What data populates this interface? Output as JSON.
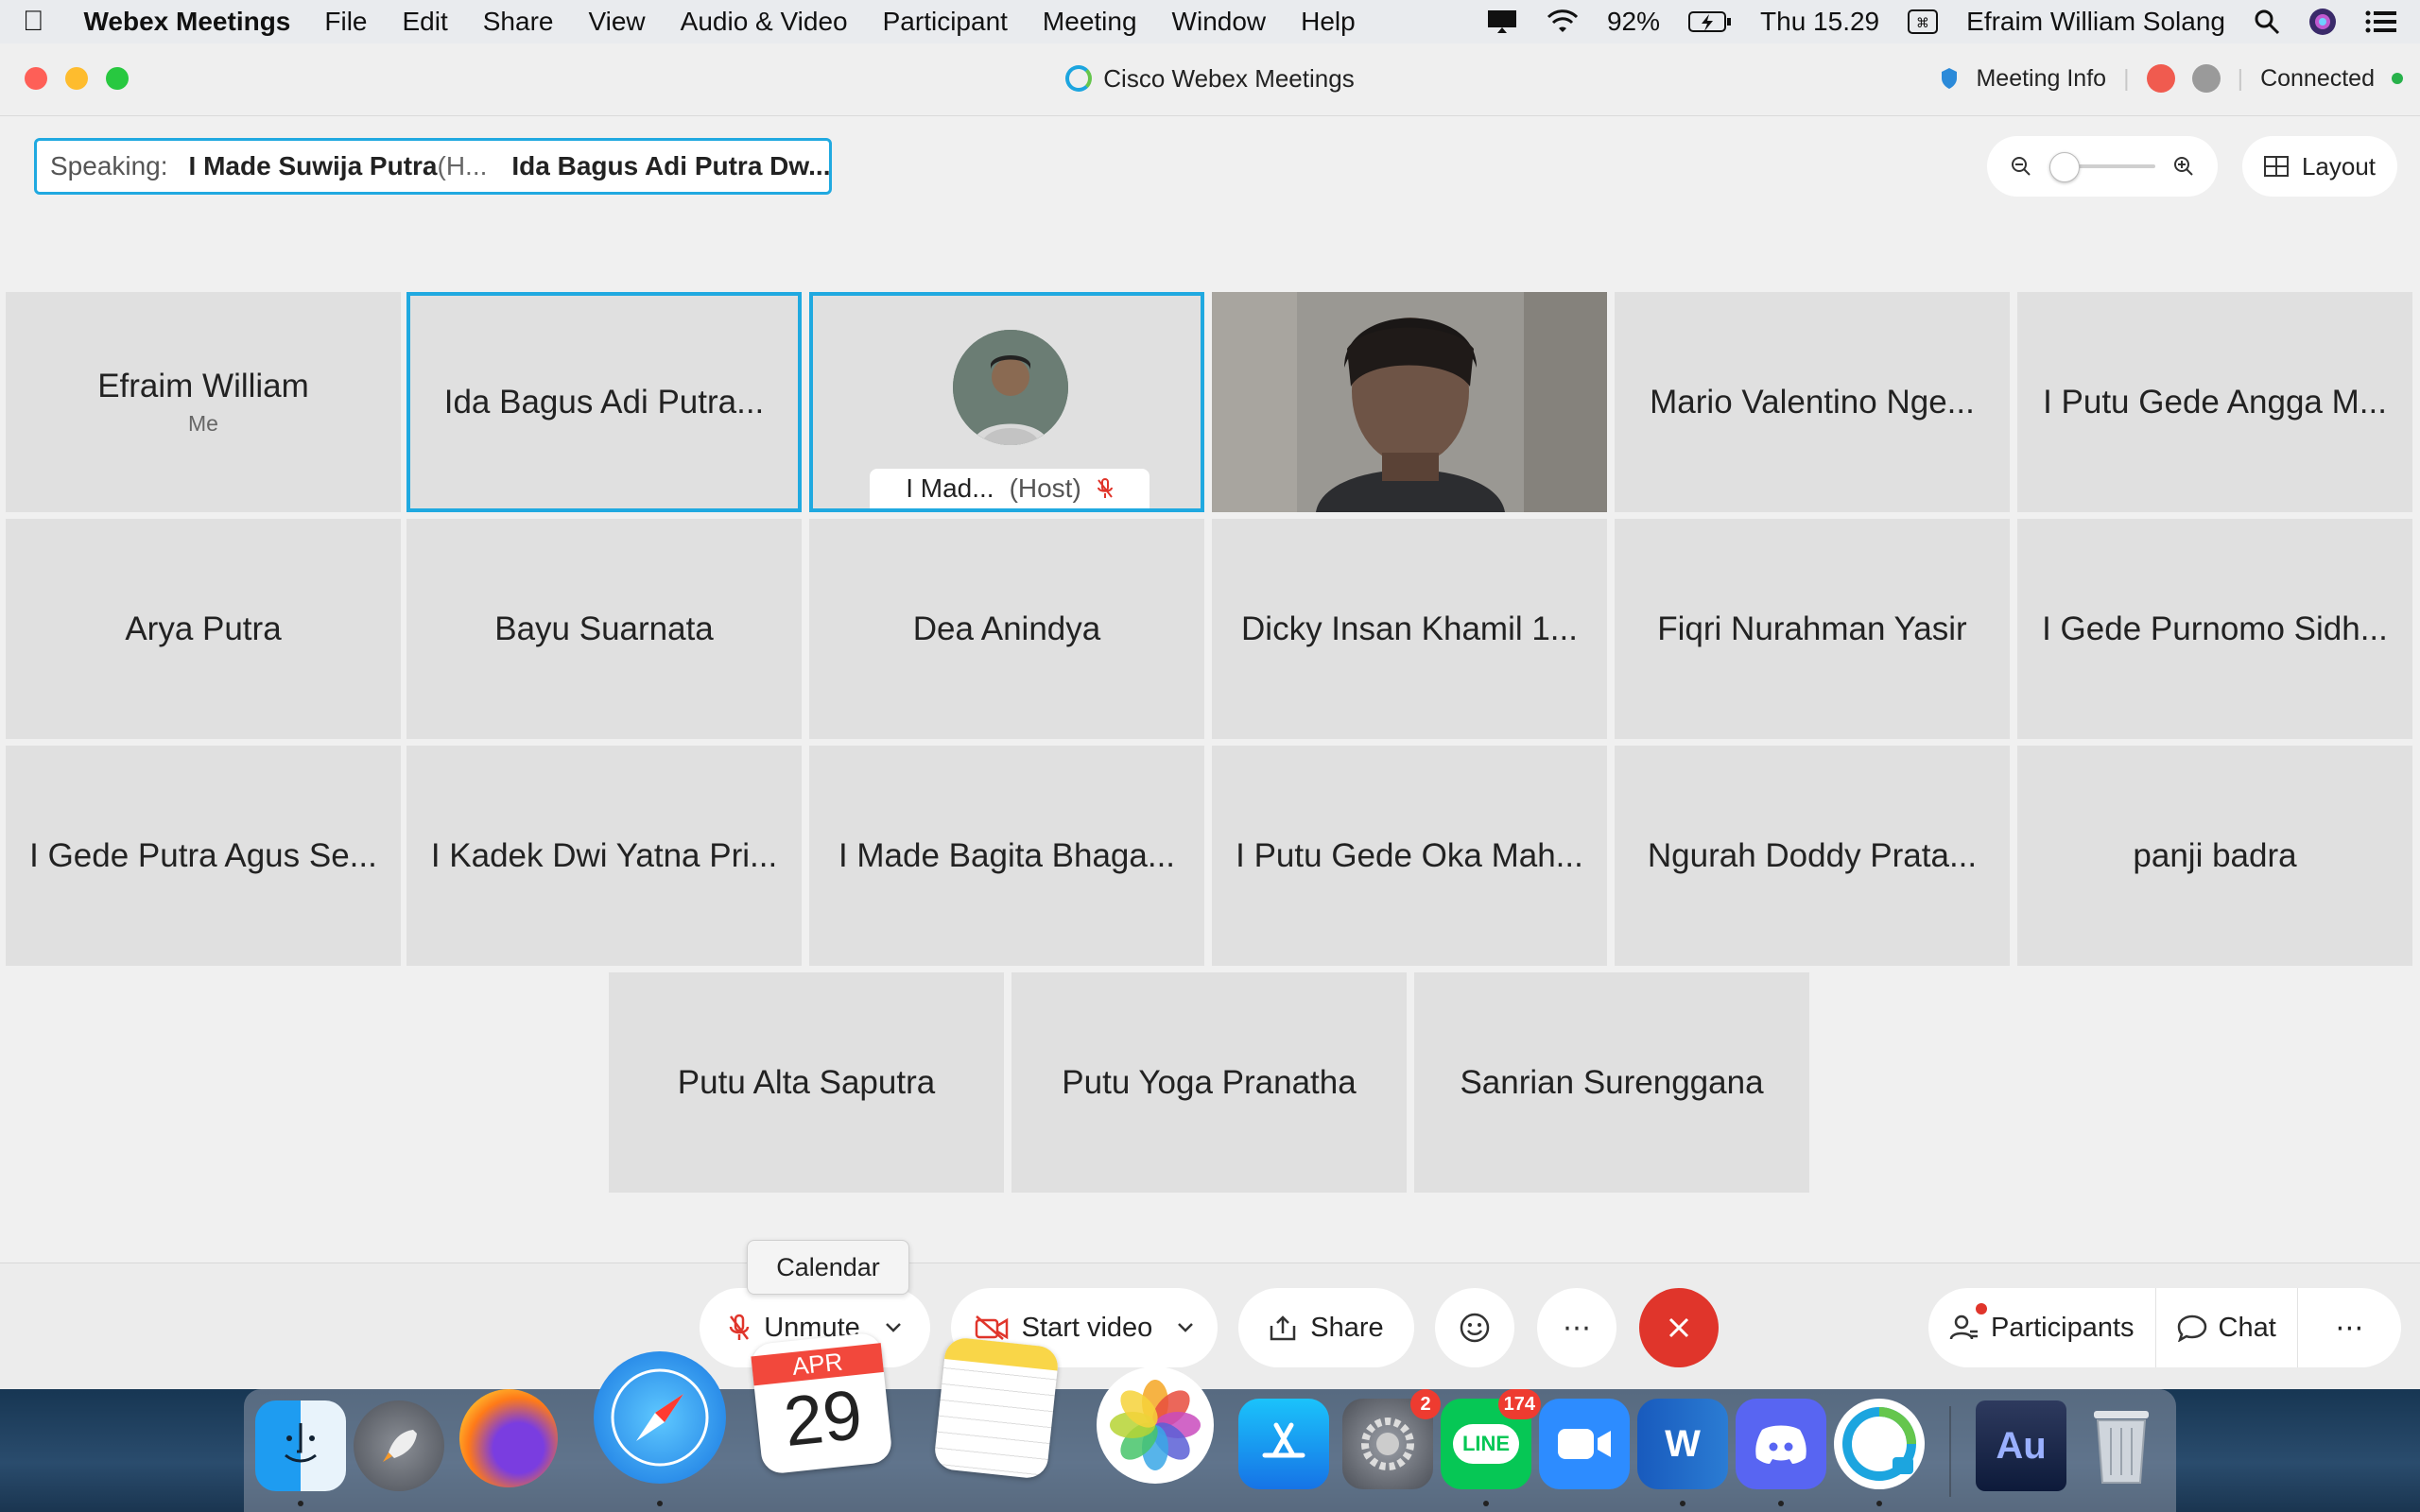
{
  "menubar": {
    "app_name": "Webex Meetings",
    "items": [
      "File",
      "Edit",
      "Share",
      "View",
      "Audio & Video",
      "Participant",
      "Meeting",
      "Window",
      "Help"
    ],
    "battery": "92%",
    "clock": "Thu 15.29",
    "user": "Efraim William Solang"
  },
  "window": {
    "title": "Cisco Webex Meetings",
    "meeting_info": "Meeting Info",
    "status": "Connected"
  },
  "speaking": {
    "label": "Speaking:",
    "speaker1": "I Made Suwija Putra",
    "speaker1_suffix": "(H...",
    "speaker2": "Ida Bagus Adi Putra Dw..."
  },
  "layout_button": "Layout",
  "tiles": {
    "r1": [
      "Efraim William",
      "Ida Bagus Adi Putra...",
      "",
      "",
      "Mario Valentino Nge...",
      "I Putu Gede Angga M..."
    ],
    "me_label": "Me",
    "host_name": "I Mad...",
    "host_tag": "(Host)",
    "r2": [
      "Arya Putra",
      "Bayu Suarnata",
      "Dea Anindya",
      "Dicky Insan Khamil 1...",
      "Fiqri Nurahman Yasir",
      "I Gede Purnomo Sidh..."
    ],
    "r3": [
      "I Gede Putra Agus Se...",
      "I Kadek Dwi Yatna Pri...",
      "I Made Bagita Bhaga...",
      "I Putu Gede Oka Mah...",
      "Ngurah Doddy Prata...",
      "panji badra"
    ],
    "r4": [
      "Putu Alta Saputra",
      "Putu Yoga Pranatha",
      "Sanrian Surenggana"
    ]
  },
  "controls": {
    "unmute": "Unmute",
    "start_video": "Start video",
    "share": "Share",
    "participants": "Participants",
    "chat": "Chat",
    "more": "⋯"
  },
  "tooltip": "Calendar",
  "dock": {
    "calendar_month": "APR",
    "calendar_day": "29",
    "settings_badge": "2",
    "line_badge": "174",
    "line_text": "LINE",
    "word_text": "W",
    "au_text": "Au"
  },
  "colors": {
    "accent": "#20a9e0",
    "end_call": "#e0352b",
    "mute_red": "#e0352b"
  }
}
